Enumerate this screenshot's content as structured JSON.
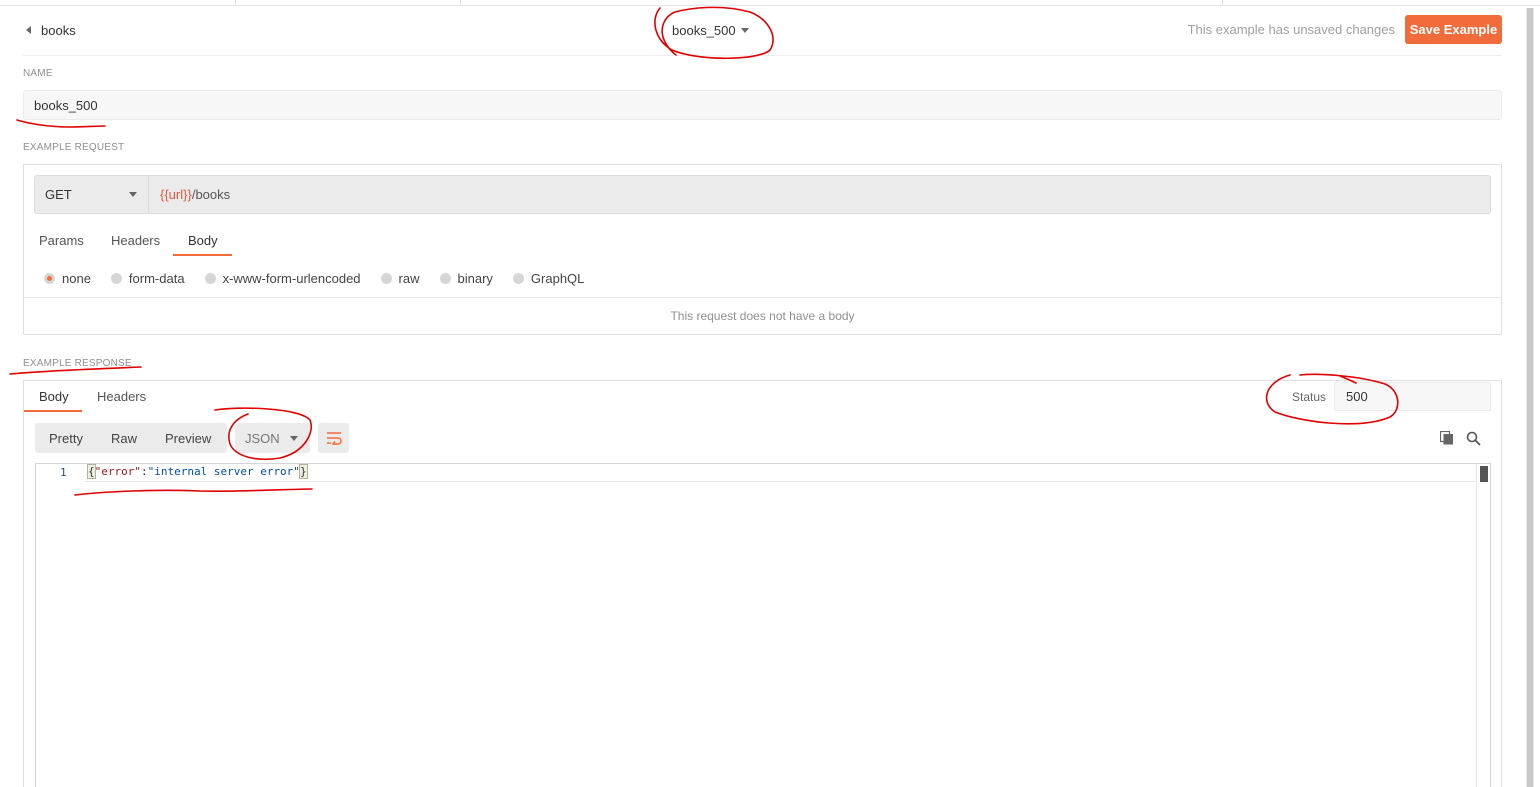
{
  "header": {
    "back_label": "books",
    "example_name": "books_500",
    "unsaved_text": "This example has unsaved changes",
    "save_label": "Save Example"
  },
  "name_section": {
    "label": "NAME",
    "value": "books_500"
  },
  "request": {
    "label": "EXAMPLE REQUEST",
    "method": "GET",
    "url_variable": "{{url}}",
    "url_path": "/books",
    "tabs": [
      "Params",
      "Headers",
      "Body"
    ],
    "active_tab": "Body",
    "body_types": [
      "none",
      "form-data",
      "x-www-form-urlencoded",
      "raw",
      "binary",
      "GraphQL"
    ],
    "selected_body_type": "none",
    "empty_body_text": "This request does not have a body"
  },
  "response": {
    "label": "EXAMPLE RESPONSE",
    "tabs": [
      "Body",
      "Headers"
    ],
    "active_tab": "Body",
    "status_label": "Status",
    "status_value": "500",
    "format_buttons": [
      "Pretty",
      "Raw",
      "Preview"
    ],
    "language": "JSON",
    "code": {
      "line_number": "1",
      "open_brace": "{",
      "key": "\"error\"",
      "colon": ":",
      "value": "\"internal server error\"",
      "close_brace": "}"
    }
  },
  "icons": {
    "back": "caret-left-icon",
    "dropdown": "caret-down-icon",
    "wrap": "word-wrap-icon",
    "copy": "copy-icon",
    "search": "search-icon"
  },
  "colors": {
    "accent": "#f26b3a",
    "variable": "#e8553e",
    "annotation": "#e00000"
  }
}
